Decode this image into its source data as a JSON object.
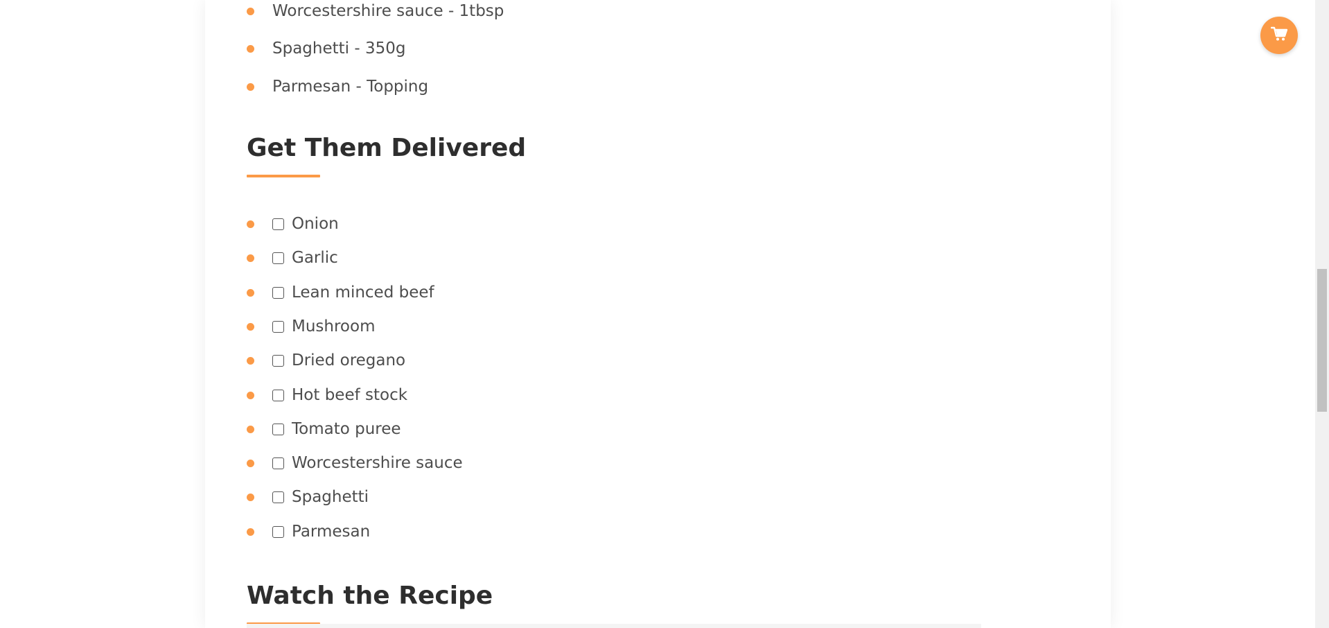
{
  "ingredients_tail": [
    "Worcestershire sauce - 1tbsp",
    "Spaghetti - 350g",
    "Parmesan - Topping"
  ],
  "delivery_section": {
    "heading": "Get Them Delivered",
    "items": [
      "Onion",
      "Garlic",
      "Lean minced beef",
      "Mushroom",
      "Dried oregano",
      "Hot beef stock",
      "Tomato puree",
      "Worcestershire sauce",
      "Spaghetti",
      "Parmesan"
    ]
  },
  "watch_section": {
    "heading": "Watch the Recipe"
  },
  "cart": {
    "icon": "cart-icon"
  },
  "colors": {
    "accent": "#fb9a47",
    "heading": "#2e2e2e",
    "text": "#4d4d4d"
  }
}
